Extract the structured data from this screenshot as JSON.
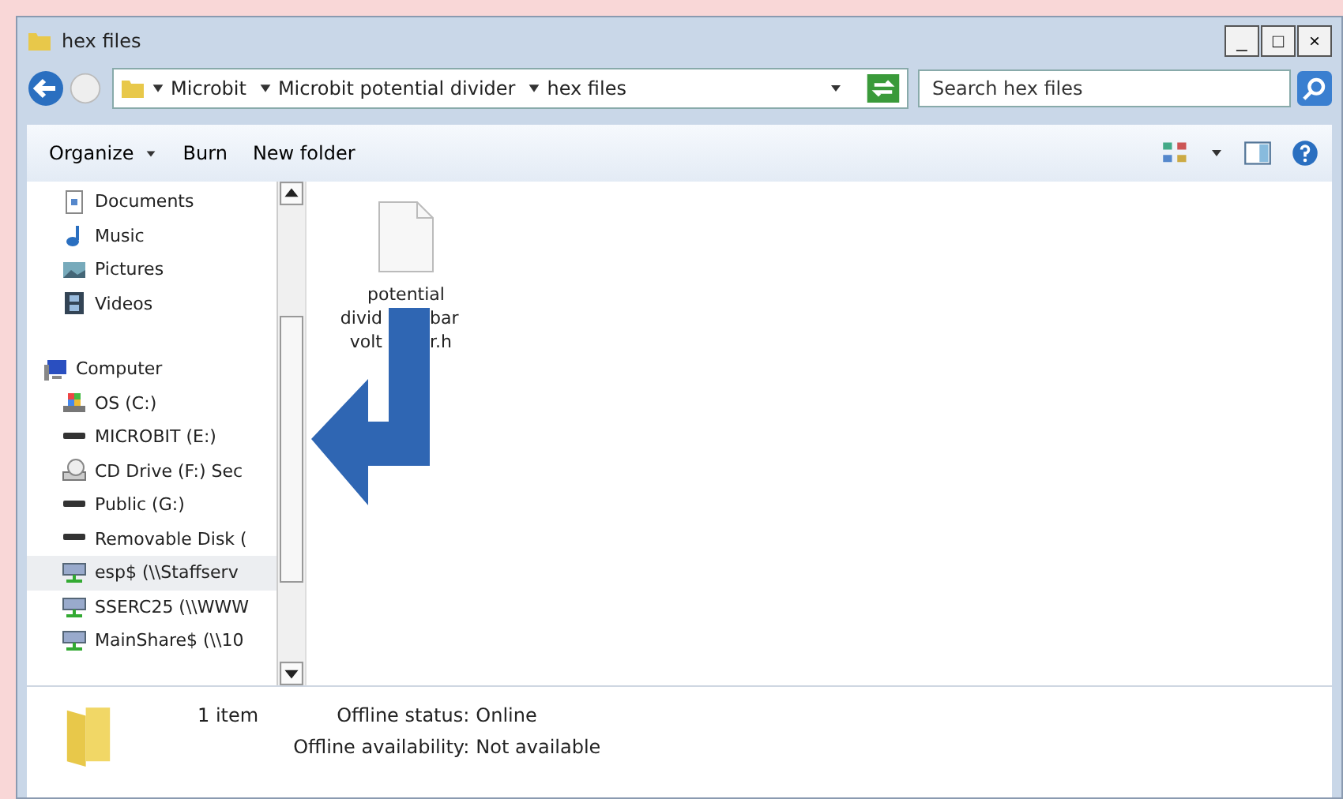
{
  "window": {
    "title": "hex files",
    "controls": [
      "_",
      "□",
      "×"
    ]
  },
  "address": {
    "crumbs": [
      "Microbit",
      "Microbit potential divider",
      "hex files"
    ]
  },
  "search": {
    "placeholder": "Search hex files"
  },
  "toolbar": {
    "items": [
      {
        "label": "Organize",
        "dropdown": true
      },
      {
        "label": "Burn",
        "dropdown": false
      },
      {
        "label": "New folder",
        "dropdown": false
      }
    ]
  },
  "sidebar": {
    "groups": [
      {
        "children": [
          {
            "label": "Documents",
            "kind": "documents",
            "selected": false
          },
          {
            "label": "Music",
            "kind": "music",
            "selected": false
          },
          {
            "label": "Pictures",
            "kind": "pictures",
            "selected": false
          },
          {
            "label": "Videos",
            "kind": "videos",
            "selected": false
          }
        ]
      },
      {
        "label": "Computer",
        "kind": "computer",
        "selected": false,
        "children": [
          {
            "label": "OS (C:)",
            "kind": "os",
            "selected": false
          },
          {
            "label": "MICROBIT (E:)",
            "kind": "drive",
            "selected": false
          },
          {
            "label": "CD Drive (F:) Sec",
            "kind": "cd",
            "selected": false
          },
          {
            "label": "Public (G:)",
            "kind": "drive",
            "selected": false
          },
          {
            "label": "Removable Disk (",
            "kind": "drive",
            "selected": false
          },
          {
            "label": "esp$ (\\\\Staffserv",
            "kind": "network",
            "selected": true
          },
          {
            "label": "SSERC25 (\\\\WWW",
            "kind": "network",
            "selected": false
          },
          {
            "label": "MainShare$ (\\\\10",
            "kind": "network",
            "selected": false
          }
        ]
      }
    ]
  },
  "files": [
    {
      "name_lines": [
        [
          "potential"
        ],
        [
          "divid",
          "bar"
        ],
        [
          "volt",
          "r.h"
        ]
      ]
    }
  ],
  "status_bar": {
    "count": "1 item",
    "fields": [
      {
        "label": "Offline status:",
        "value": "Online"
      },
      {
        "label": "Offline availability:",
        "value": "Not available"
      }
    ]
  }
}
